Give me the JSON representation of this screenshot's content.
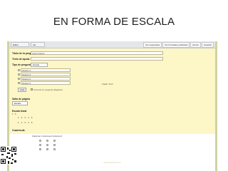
{
  "slide": {
    "title": "EN FORMA DE ESCALA"
  },
  "browser": {
    "tabs": [
      "Editar formulario",
      "Ver formulario"
    ],
    "right_buttons": [
      "Ver respuestas",
      "Ver formulario publicado",
      "Enviar",
      "Guardar"
    ]
  },
  "form": {
    "question_title_label": "Título de la pregunta",
    "question_title_value": "Lorem ipsum",
    "help_text_label": "Texto de ayuda",
    "question_type_label": "Tipo de pregunta",
    "question_type_value": "Escala",
    "options": [
      "Opción 1",
      "Opción 2",
      "Opción 3",
      "Opción 4"
    ],
    "other_option_link": "Añadir \"Otro\"",
    "done_button": "Listo",
    "required_label": "Convertir en pregunta obligatoria",
    "section2_label": "Salto de página",
    "section2_select": "Escala",
    "scale_label": "Escala lineal",
    "scale_hint": "1 - 5",
    "scale_values_1": [
      "1",
      "2",
      "3",
      "4",
      "5"
    ],
    "scale_values_2": [
      "1",
      "2",
      "3",
      "4",
      "5"
    ],
    "grid_label": "Cuadrícula",
    "grid_header": "Columna 1   Columna 2   Columna 3"
  },
  "footer": {
    "watermark": "www.ejemplo.com"
  },
  "colors": {
    "panel": "#fdf6c6",
    "frame": "#cfd4a0",
    "text": "#1e1e1e"
  }
}
